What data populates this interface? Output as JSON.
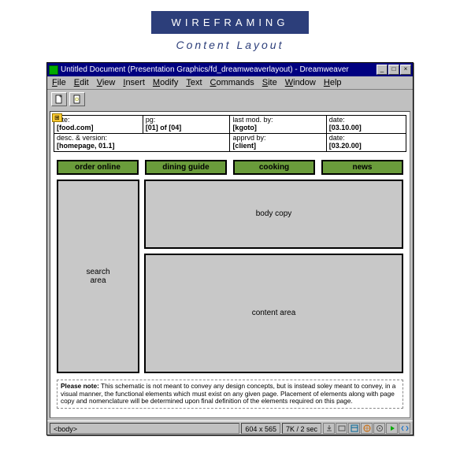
{
  "banner": "WIREFRAMING",
  "subtitle": "Content Layout",
  "window": {
    "title": "Untitled Document (Presentation Graphics/fd_dreamweaverlayout) - Dreamweaver",
    "menu": [
      "File",
      "Edit",
      "View",
      "Insert",
      "Modify",
      "Text",
      "Commands",
      "Site",
      "Window",
      "Help"
    ]
  },
  "info": {
    "r1c1_label": "site:",
    "r1c1_val": "[food.com]",
    "r1c2_label": "pg:",
    "r1c2_val": "[01] of [04]",
    "r1c3_label": "last mod. by:",
    "r1c3_val": "[kgoto]",
    "r1c4_label": "date:",
    "r1c4_val": "[03.10.00]",
    "r2c1_label": "desc. & version:",
    "r2c1_val": "[homepage, 01.1]",
    "r2c3_label": "apprvd by:",
    "r2c3_val": "[client]",
    "r2c4_label": "date:",
    "r2c4_val": "[03.20.00]"
  },
  "nav": [
    "order online",
    "dining guide",
    "cooking",
    "news"
  ],
  "blocks": {
    "search": "search\narea",
    "body": "body copy",
    "content": "content area"
  },
  "note_label": "Please note:",
  "note_text": " This schematic is not meant to convey any design concepts, but is instead soley meant to convey, in a visual manner, the functional elements which must exist on any given page. Placement of elements along with page copy and nomenclature will be determined upon final definition of the elements required on this page.",
  "status": {
    "tag": "<body>",
    "dims": "604 x 565",
    "size": "7K / 2 sec"
  }
}
